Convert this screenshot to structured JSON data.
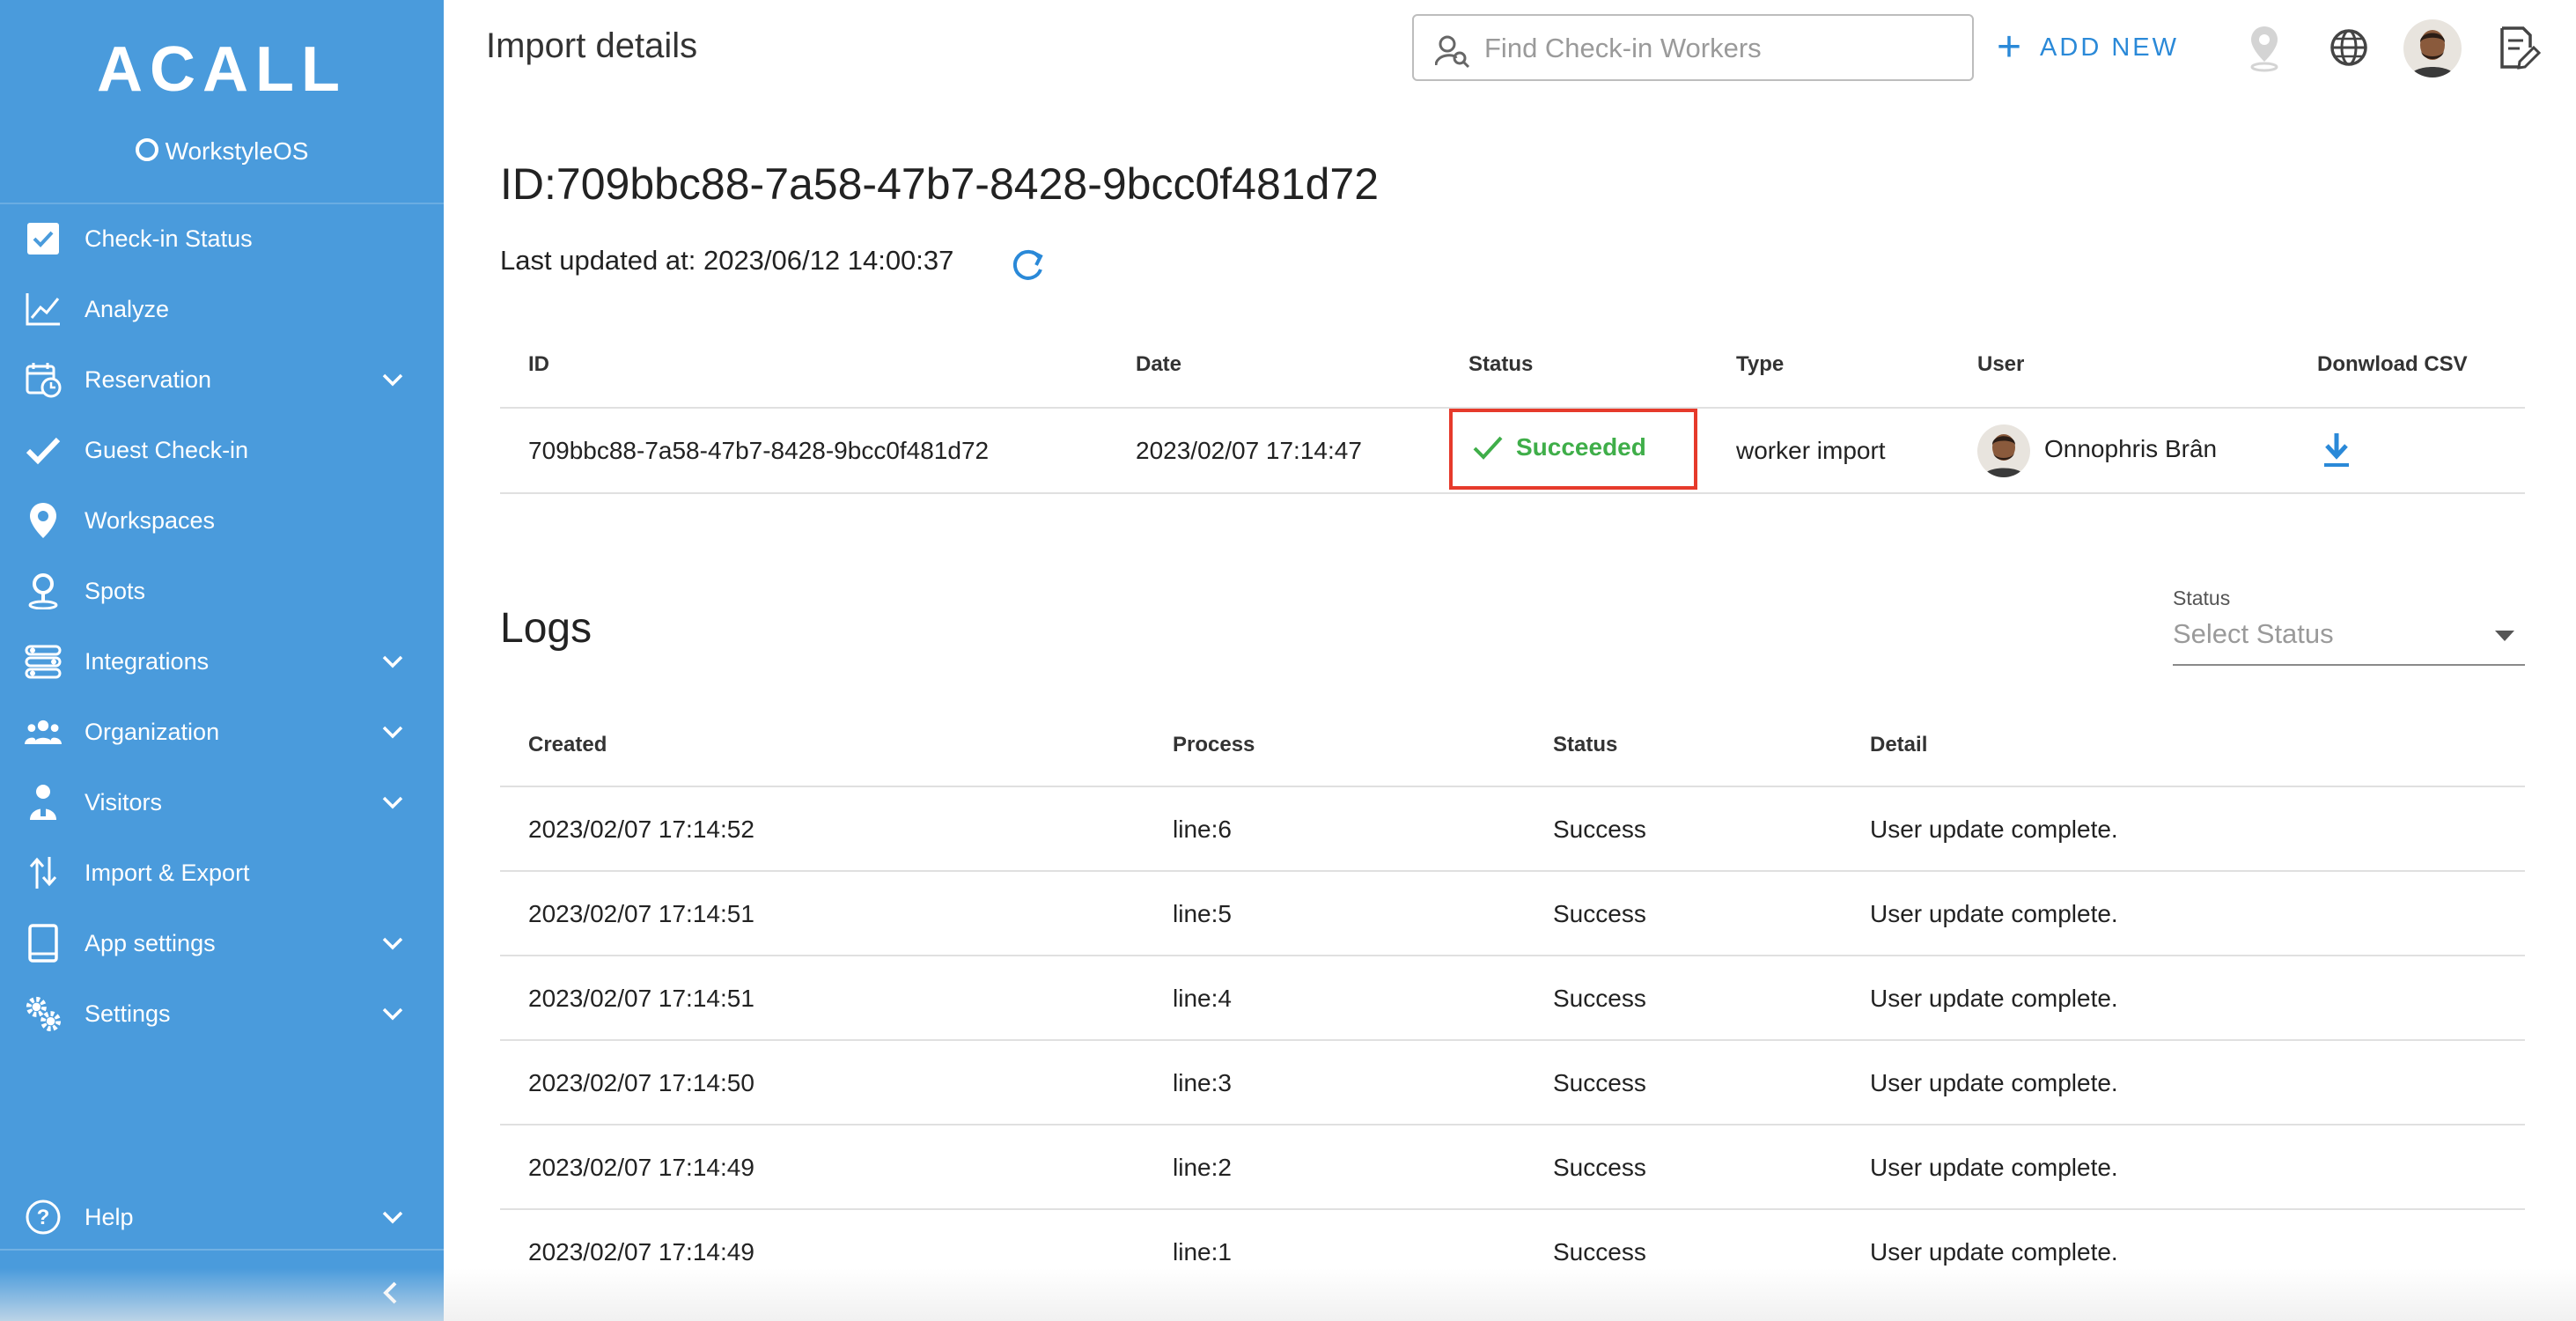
{
  "sidebar": {
    "logo": "ACALL",
    "sublogo": "WorkstyleOS",
    "items": [
      {
        "label": "Check-in Status",
        "icon": "check-square-icon",
        "expandable": false
      },
      {
        "label": "Analyze",
        "icon": "line-chart-icon",
        "expandable": false
      },
      {
        "label": "Reservation",
        "icon": "calendar-clock-icon",
        "expandable": true
      },
      {
        "label": "Guest Check-in",
        "icon": "checkmark-icon",
        "expandable": false
      },
      {
        "label": "Workspaces",
        "icon": "map-pin-icon",
        "expandable": false
      },
      {
        "label": "Spots",
        "icon": "person-pin-icon",
        "expandable": false
      },
      {
        "label": "Integrations",
        "icon": "integrations-icon",
        "expandable": true
      },
      {
        "label": "Organization",
        "icon": "people-group-icon",
        "expandable": true
      },
      {
        "label": "Visitors",
        "icon": "visitor-badge-icon",
        "expandable": true
      },
      {
        "label": "Import & Export",
        "icon": "import-export-icon",
        "expandable": false
      },
      {
        "label": "App settings",
        "icon": "tablet-icon",
        "expandable": true
      },
      {
        "label": "Settings",
        "icon": "gears-icon",
        "expandable": true
      }
    ],
    "help": {
      "label": "Help",
      "icon": "help-circle-icon",
      "expandable": true
    }
  },
  "header": {
    "title": "Import details",
    "search_placeholder": "Find Check-in Workers",
    "add_new": "ADD NEW"
  },
  "detail": {
    "id_title": "ID:709bbc88-7a58-47b7-8428-9bcc0f481d72",
    "last_updated": "Last updated at: 2023/06/12 14:00:37",
    "columns": [
      "ID",
      "Date",
      "Status",
      "Type",
      "User",
      "Donwload CSV"
    ],
    "row": {
      "id": "709bbc88-7a58-47b7-8428-9bcc0f481d72",
      "date": "2023/02/07 17:14:47",
      "status": "Succeeded",
      "type": "worker import",
      "user": "Onnophris Brân"
    }
  },
  "logs": {
    "title": "Logs",
    "filter_label": "Status",
    "filter_placeholder": "Select Status",
    "columns": [
      "Created",
      "Process",
      "Status",
      "Detail"
    ],
    "rows": [
      {
        "created": "2023/02/07 17:14:52",
        "process": "line:6",
        "status": "Success",
        "detail": "User update complete."
      },
      {
        "created": "2023/02/07 17:14:51",
        "process": "line:5",
        "status": "Success",
        "detail": "User update complete."
      },
      {
        "created": "2023/02/07 17:14:51",
        "process": "line:4",
        "status": "Success",
        "detail": "User update complete."
      },
      {
        "created": "2023/02/07 17:14:50",
        "process": "line:3",
        "status": "Success",
        "detail": "User update complete."
      },
      {
        "created": "2023/02/07 17:14:49",
        "process": "line:2",
        "status": "Success",
        "detail": "User update complete."
      },
      {
        "created": "2023/02/07 17:14:49",
        "process": "line:1",
        "status": "Success",
        "detail": "User update complete."
      }
    ]
  },
  "colors": {
    "sidebar": "#4a9bdc",
    "accent": "#2a89d8",
    "success": "#3fae49",
    "highlight_border": "#e63a2b"
  }
}
